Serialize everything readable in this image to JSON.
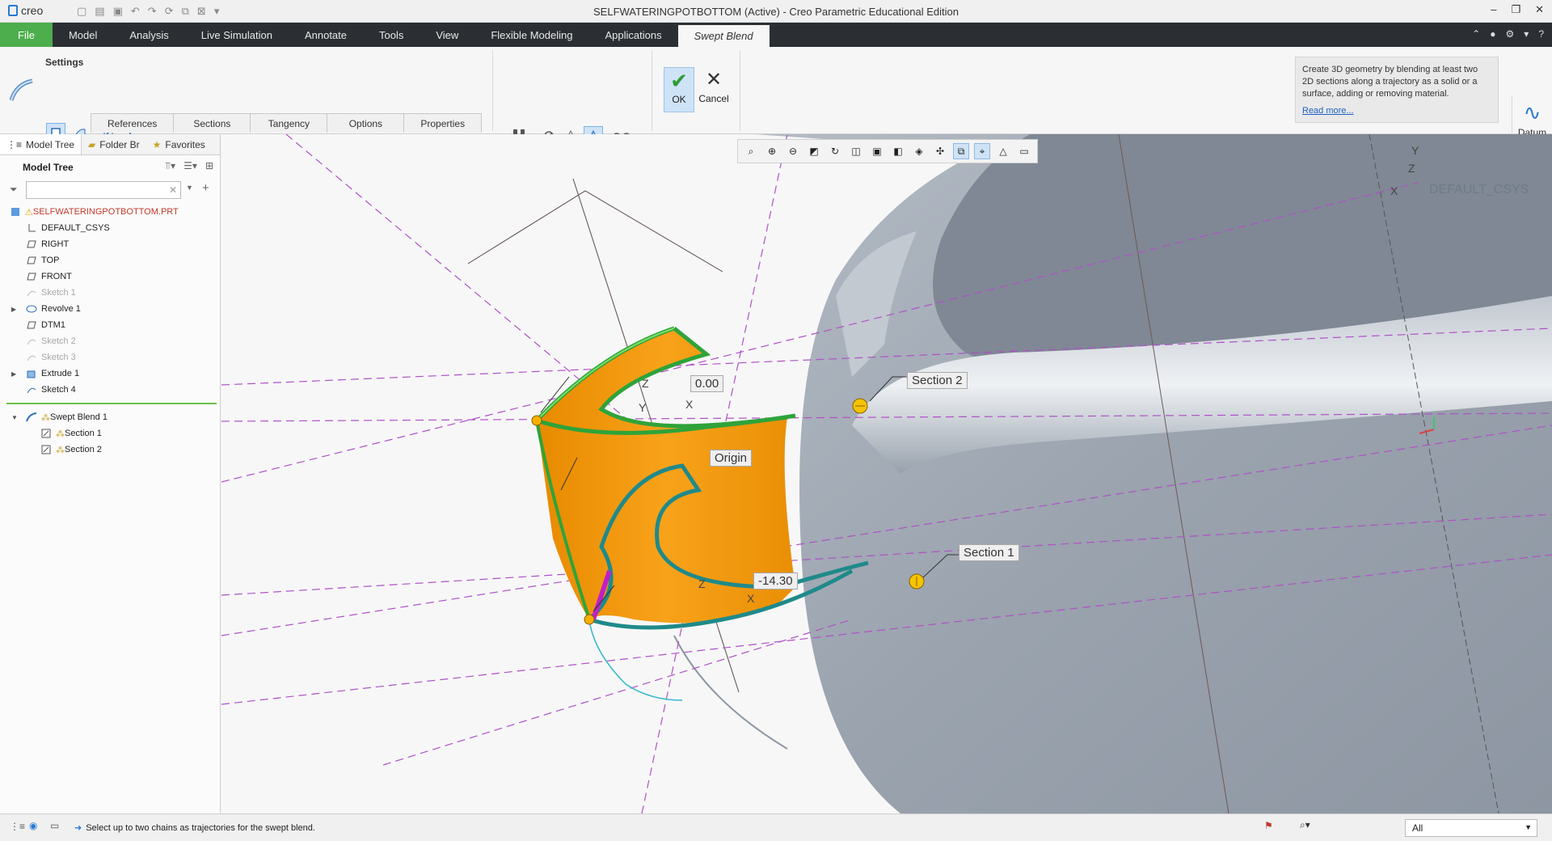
{
  "window": {
    "app_name": "creo",
    "title": "SELFWATERINGPOTBOTTOM (Active) - Creo Parametric Educational Edition"
  },
  "ribbon_tabs": [
    {
      "label": "File"
    },
    {
      "label": "Model"
    },
    {
      "label": "Analysis"
    },
    {
      "label": "Live Simulation"
    },
    {
      "label": "Annotate"
    },
    {
      "label": "Tools"
    },
    {
      "label": "View"
    },
    {
      "label": "Flexible Modeling"
    },
    {
      "label": "Applications"
    },
    {
      "label": "Swept Blend"
    }
  ],
  "dashboard": {
    "settings_label": "Settings",
    "tabs": [
      "References",
      "Sections",
      "Tangency",
      "Options",
      "Properties"
    ],
    "ok_label": "OK",
    "cancel_label": "Cancel",
    "help_text": "Create 3D geometry by blending at least two 2D sections along a trajectory as a solid or a surface, adding or removing material.",
    "read_more": "Read more...",
    "datum_label": "Datum"
  },
  "left_panel": {
    "tabs": [
      "Model Tree",
      "Folder Br",
      "Favorites"
    ],
    "header": "Model Tree",
    "tree": [
      {
        "label": "SELFWATERINGPOTBOTTOM.PRT",
        "icon": "part-icon",
        "state": "root",
        "level": 0
      },
      {
        "label": "DEFAULT_CSYS",
        "icon": "csys-icon",
        "state": "normal",
        "level": 1
      },
      {
        "label": "RIGHT",
        "icon": "datum-plane-icon",
        "state": "normal",
        "level": 1
      },
      {
        "label": "TOP",
        "icon": "datum-plane-icon",
        "state": "normal",
        "level": 1
      },
      {
        "label": "FRONT",
        "icon": "datum-plane-icon",
        "state": "normal",
        "level": 1
      },
      {
        "label": "Sketch 1",
        "icon": "sketch-icon",
        "state": "dim",
        "level": 1
      },
      {
        "label": "Revolve 1",
        "icon": "revolve-icon",
        "state": "normal",
        "level": 1,
        "expandable": true
      },
      {
        "label": "DTM1",
        "icon": "datum-plane-icon",
        "state": "normal",
        "level": 1
      },
      {
        "label": "Sketch 2",
        "icon": "sketch-icon",
        "state": "dim",
        "level": 1
      },
      {
        "label": "Sketch 3",
        "icon": "sketch-icon",
        "state": "dim",
        "level": 1
      },
      {
        "label": "Extrude 1",
        "icon": "extrude-icon",
        "state": "normal",
        "level": 1,
        "expandable": true
      },
      {
        "label": "Sketch 4",
        "icon": "sketch-icon",
        "state": "normal",
        "level": 1
      }
    ],
    "active_feature": {
      "label": "Swept Blend 1",
      "children": [
        "Section 1",
        "Section 2"
      ]
    }
  },
  "viewport": {
    "csys_name": "DEFAULT_CSYS",
    "tags": {
      "section2": "Section 2",
      "section1": "Section 1",
      "origin": "Origin",
      "dim_top": "0.00",
      "dim_bottom": "-14.30"
    },
    "axis_letters": {
      "x": "X",
      "y": "Y",
      "z": "Z"
    }
  },
  "statusbar": {
    "message": "Select up to two chains as trajectories for the swept blend.",
    "filter_value": "All"
  },
  "colors": {
    "accent_green": "#4cae4c",
    "ribbon_dark": "#2b2f33",
    "selection_blue": "#cfe3f7",
    "model_gray": "#a3abb6",
    "preview_orange": "#f29a0c"
  }
}
